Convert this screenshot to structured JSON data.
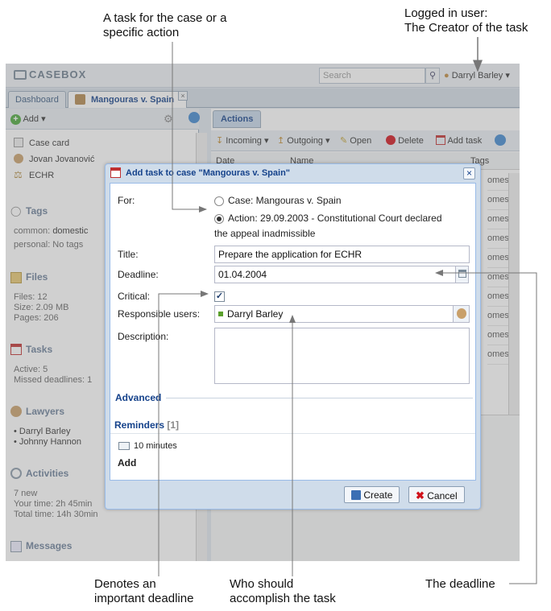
{
  "annotations": {
    "task_for": [
      "A task for the case or a",
      "specific action"
    ],
    "logged_user": [
      "Logged in user:",
      "The Creator of the task"
    ],
    "important_deadline": [
      "Denotes an",
      "important deadline"
    ],
    "who_accomplish": [
      "Who should",
      "accomplish the task"
    ],
    "the_deadline": "The deadline"
  },
  "app": {
    "logo": "CASEBOX",
    "search_placeholder": "Search",
    "user": "Darryl Barley",
    "tabs": [
      "Dashboard",
      "Mangouras v. Spain"
    ]
  },
  "left": {
    "add_label": "Add",
    "items": [
      "Case card",
      "Jovan Jovanović",
      "ECHR"
    ],
    "tags": {
      "title": "Tags",
      "common_label": "common:",
      "common_value": "domestic",
      "personal": "personal: No tags"
    },
    "files": {
      "title": "Files",
      "lines": [
        "Files: 12",
        "Size: 2.09 MB",
        "Pages: 206"
      ]
    },
    "tasks": {
      "title": "Tasks",
      "lines": [
        "Active: 5",
        "Missed deadlines: 1"
      ]
    },
    "lawyers": {
      "title": "Lawyers",
      "names": [
        "Darryl Barley",
        "Johnny Hannon"
      ]
    },
    "activities": {
      "title": "Activities",
      "lines": [
        "7 new",
        "Your time: 2h 45min",
        "Total time: 14h 30min"
      ]
    },
    "messages": {
      "title": "Messages"
    }
  },
  "right": {
    "tab": "Actions",
    "toolbar": {
      "incoming": "Incoming",
      "outgoing": "Outgoing",
      "open": "Open",
      "delete": "Delete",
      "add_task": "Add task"
    },
    "columns": [
      "Date",
      "Name",
      "Tags"
    ],
    "tag_cells": [
      "omestic",
      "omestic",
      "omestic",
      "omestic",
      "omestic",
      "omestic",
      "omestic",
      "omestic",
      "omestic",
      "omestic"
    ]
  },
  "dialog": {
    "title": "Add task to case \"Mangouras v. Spain\"",
    "for_label": "For:",
    "option_case": "Case: Mangouras v. Spain",
    "option_action_line1": "Action: 29.09.2003 - Constitutional Court declared",
    "option_action_line2": "the appeal inadmissible",
    "title_label": "Title:",
    "title_value": "Prepare the application for ECHR",
    "deadline_label": "Deadline:",
    "deadline_value": "01.04.2004",
    "critical_label": "Critical:",
    "responsible_label": "Responsible users:",
    "responsible_user": "Darryl Barley",
    "description_label": "Description:",
    "advanced": "Advanced",
    "reminders": "Reminders",
    "reminders_count": "[1]",
    "reminder_item": "10 minutes",
    "add_reminder": "Add",
    "create": "Create",
    "cancel": "Cancel"
  },
  "colors": {
    "dialog_title": "#15428b",
    "accent": "#99bbe8",
    "cancel_icon": "#d0121b",
    "create_icon": "#3b6fb4"
  }
}
